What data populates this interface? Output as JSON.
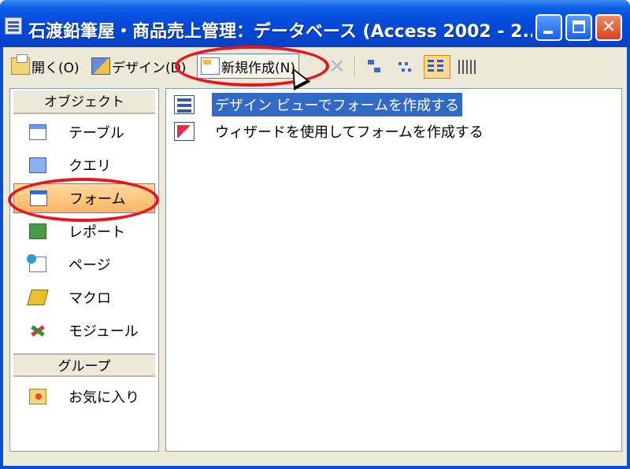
{
  "window": {
    "title": "石渡鉛筆屋・商品売上管理：データベース (Access 2002 - 2...",
    "controls": {
      "minimize": "_",
      "maximize": "□",
      "close": "✕"
    }
  },
  "toolbar": {
    "open_label": "開く(O)",
    "design_label": "デザイン(D)",
    "new_label": "新規作成(N)",
    "delete_icon": "✕"
  },
  "sidebar": {
    "objects_header": "オブジェクト",
    "items": [
      {
        "label": "テーブル",
        "icon": "table-icon"
      },
      {
        "label": "クエリ",
        "icon": "query-icon"
      },
      {
        "label": "フォーム",
        "icon": "form-icon",
        "selected": true
      },
      {
        "label": "レポート",
        "icon": "report-icon"
      },
      {
        "label": "ページ",
        "icon": "page-icon"
      },
      {
        "label": "マクロ",
        "icon": "macro-icon"
      },
      {
        "label": "モジュール",
        "icon": "module-icon"
      }
    ],
    "groups_header": "グループ",
    "groups": [
      {
        "label": "お気に入り",
        "icon": "favorites-folder-icon"
      }
    ]
  },
  "main": {
    "items": [
      {
        "label": "デザイン ビューでフォームを作成する",
        "icon": "design-view-icon",
        "selected": true
      },
      {
        "label": "ウィザードを使用してフォームを作成する",
        "icon": "wizard-icon"
      }
    ]
  },
  "colors": {
    "titlebar": "#0549d8",
    "highlight_ellipse": "#e8161c",
    "selection": "#316ac5",
    "selected_object": "#fbb463"
  }
}
